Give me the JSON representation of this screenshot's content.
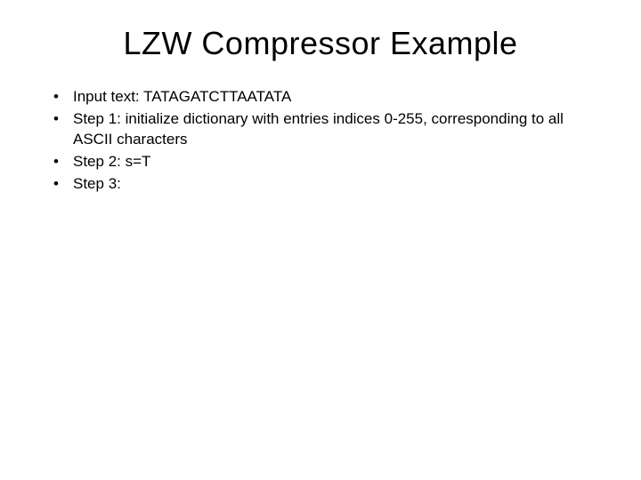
{
  "slide": {
    "title": "LZW Compressor Example",
    "bullets": [
      "Input text: TATAGATCTTAATATA",
      "Step 1: initialize dictionary with entries indices 0-255, corresponding to all ASCII characters",
      "Step 2: s=T",
      "Step 3:"
    ]
  }
}
